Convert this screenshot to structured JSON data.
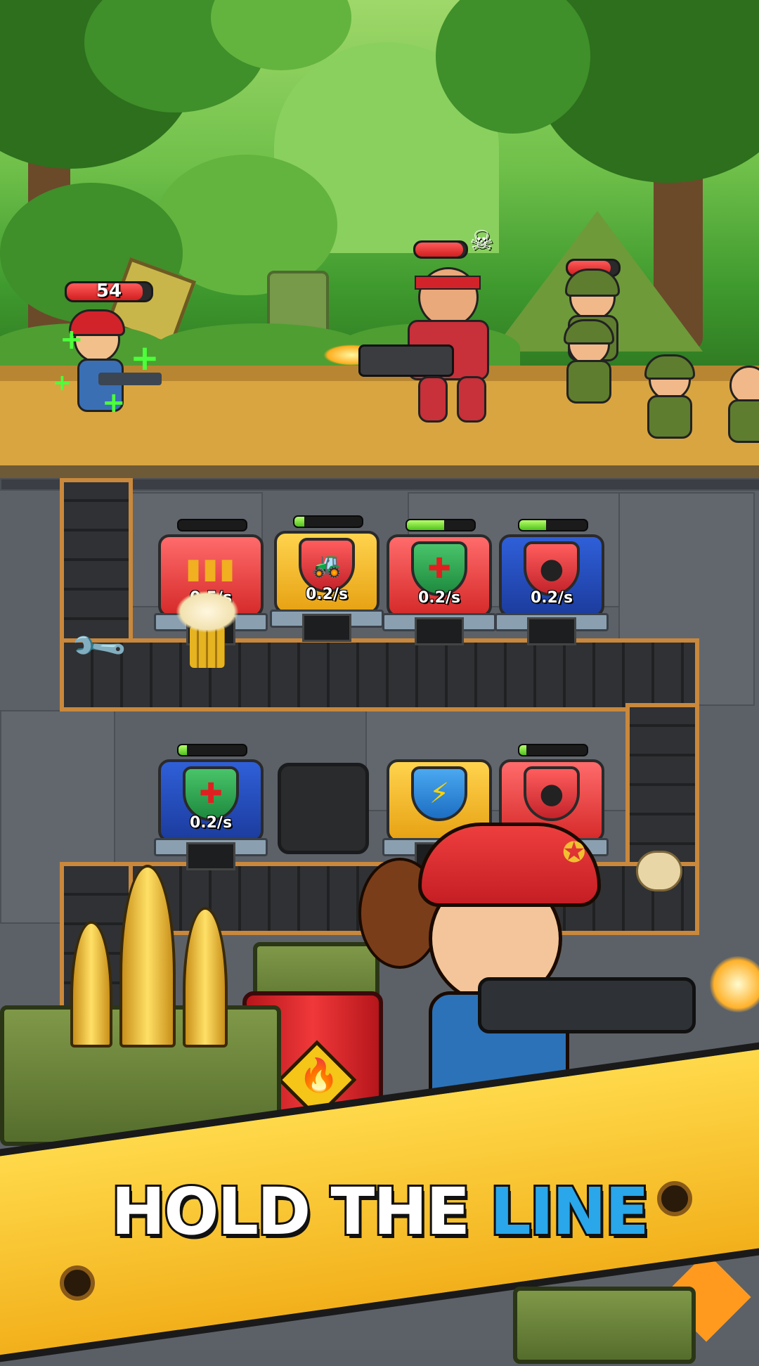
{
  "battle": {
    "player": {
      "hp_value": "54",
      "hp_fraction": 0.9
    },
    "boss": {
      "hp_fraction": 0.95,
      "skull_icon": "skull-icon"
    },
    "enemy_group": {
      "hp_fraction": 0.85
    }
  },
  "factory": {
    "row1": [
      {
        "icon": "bullets-icon",
        "glyph": "▮▮▮",
        "color": "red",
        "rate": "0.5/s",
        "progress": 0.0
      },
      {
        "icon": "bulldozer-icon",
        "glyph": "🚜",
        "color": "yellow",
        "rate": "0.2/s",
        "progress": 0.15
      },
      {
        "icon": "medkit-icon",
        "glyph": "✚",
        "color": "red",
        "rate": "0.2/s",
        "progress": 0.55
      },
      {
        "icon": "bomb-icon",
        "glyph": "●",
        "color": "blue",
        "rate": "0.2/s",
        "progress": 0.4
      }
    ],
    "row2": [
      {
        "icon": "medkit-icon",
        "glyph": "✚",
        "color": "blue",
        "rate": "0.2/s",
        "progress": 0.12
      },
      {
        "icon": "lightning-icon",
        "glyph": "⚡",
        "color": "yellow",
        "rate": "",
        "progress": null
      },
      {
        "icon": "bomb-icon",
        "glyph": "●",
        "color": "red",
        "rate": "",
        "progress": 0.1
      }
    ],
    "wrench_icon": "wrench-icon"
  },
  "banner": {
    "text_white": "HOLD THE",
    "text_blue": "LINE"
  },
  "colors": {
    "banner_yellow": "#f2b01b",
    "headline_blue": "#29a7ea",
    "hp_red": "#d21f1f",
    "progress_green": "#4fc21c",
    "conveyor_trim": "#c9883b"
  }
}
